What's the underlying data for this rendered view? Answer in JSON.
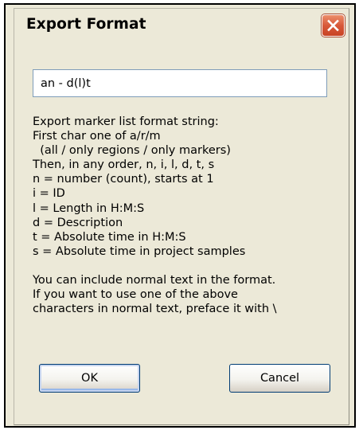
{
  "dialog": {
    "title": "Export Format",
    "close_icon": "close-x-icon",
    "format_input_value": "an - d(l)t",
    "help_lines": [
      "Export marker list format string:",
      "First char one of a/r/m",
      "  (all / only regions / only markers)",
      "Then, in any order, n, i, l, d, t, s",
      "n = number (count), starts at 1",
      "i = ID",
      "l = Length in H:M:S",
      "d = Description",
      "t = Absolute time in H:M:S",
      "s = Absolute time in project samples",
      "",
      "You can include normal text in the format.",
      "If you want to use one of the above",
      "characters in normal text, preface it with \\"
    ],
    "ok_label": "OK",
    "cancel_label": "Cancel"
  },
  "colors": {
    "dialog_background": "#ece9d8",
    "close_button": "#d8593a",
    "input_border": "#7f9db9",
    "button_border": "#003c74"
  }
}
